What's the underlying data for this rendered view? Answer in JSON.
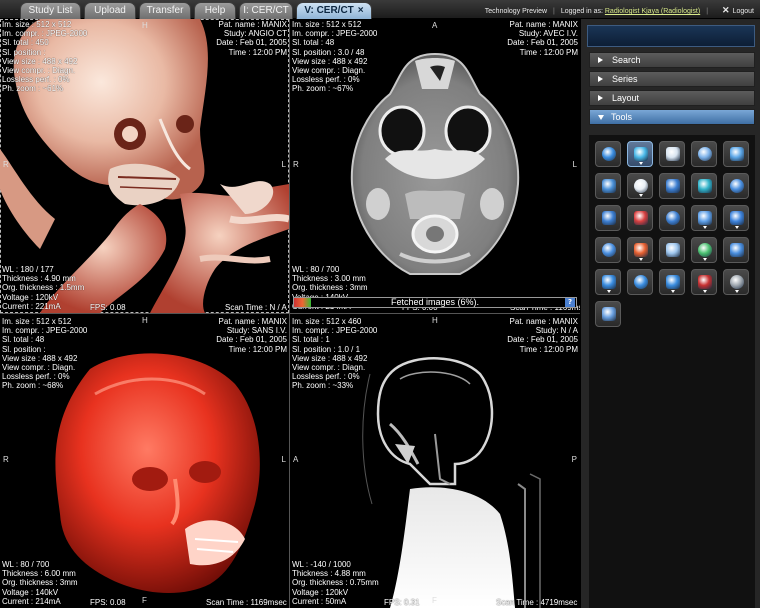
{
  "tabs": [
    {
      "label": "Study List",
      "active": false
    },
    {
      "label": "Upload",
      "active": false
    },
    {
      "label": "Transfer",
      "active": false
    },
    {
      "label": "Help",
      "active": false
    },
    {
      "label": "I: CER/CT",
      "active": false
    },
    {
      "label": "V: CER/CT",
      "active": true,
      "close": "×"
    }
  ],
  "header": {
    "tech_preview": "Technology Preview",
    "logged_in_as": "Logged in as:",
    "user": "Radiologist Kjaya (Radiologist)",
    "logout": "Logout",
    "logout_icon": "close-icon"
  },
  "viewports": {
    "top_left": {
      "left_lines": [
        "Im. size : 512 x 512",
        "Im. compr. : JPEG-2000",
        "Sl. total : 450",
        "Sl. position :",
        "View size : 488 x 492",
        "View compr. : Diagn.",
        "Lossless perf. : 0%",
        "Ph. zoom : ~61%"
      ],
      "right_lines": [
        "Pat. name : MANIX",
        "Study: ANGIO CT",
        "Date : Feb 01, 2005",
        "Time : 12:00 PM"
      ],
      "bottom_lines": [
        "WL : 180 / 177",
        "Thickness : 4.90 mm",
        "Org. thickness : 1.5mm",
        "Voltage : 120kV",
        "Current : 221mA"
      ],
      "fps": "FPS: 0.08",
      "scan": "Scan Time : N / A",
      "orient": {
        "top": "H",
        "left": "R",
        "right": "L",
        "bottom": "F"
      }
    },
    "top_right": {
      "left_lines": [
        "Im. size : 512 x 512",
        "Im. compr. : JPEG-2000",
        "Sl. total : 48",
        "Sl. position : 3.0 / 48",
        "View size : 488 x 492",
        "View compr. : Diagn.",
        "Lossless perf. : 0%",
        "Ph. zoom : ~67%"
      ],
      "right_lines": [
        "Pat. name : MANIX",
        "Study: AVEC I.V.",
        "Date : Feb 01, 2005",
        "Time : 12:00 PM"
      ],
      "bottom_lines": [
        "WL : 80 / 700",
        "Thickness : 3.00 mm",
        "Org. thickness : 3mm",
        "Voltage : 140kV",
        "Current : 214mA"
      ],
      "fps": "FPS: 0.00",
      "scan": "Scan Time : 1169msec",
      "orient": {
        "top": "A",
        "left": "R",
        "right": "L",
        "bottom": "P"
      }
    },
    "bottom_left": {
      "left_lines": [
        "Im. size : 512 x 512",
        "Im. compr. : JPEG-2000",
        "Sl. total : 48",
        "Sl. position :",
        "View size : 488 x 492",
        "View compr. : Diagn.",
        "Lossless perf. : 0%",
        "Ph. zoom : ~68%"
      ],
      "right_lines": [
        "Pat. name : MANIX",
        "Study: SANS I.V.",
        "Date : Feb 01, 2005",
        "Time : 12:00 PM"
      ],
      "bottom_lines": [
        "WL : 80 / 700",
        "Thickness : 6.00 mm",
        "Org. thickness : 3mm",
        "Voltage : 140kV",
        "Current : 214mA"
      ],
      "fps": "FPS: 0.08",
      "scan": "Scan Time : 1169msec",
      "orient": {
        "top": "H",
        "left": "R",
        "right": "L",
        "bottom": "F"
      }
    },
    "bottom_right": {
      "left_lines": [
        "Im. size : 512 x 460",
        "Im. compr. : JPEG-2000",
        "Sl. total : 1",
        "Sl. position : 1.0 / 1",
        "View size : 488 x 492",
        "View compr. : Diagn.",
        "Lossless perf. : 0%",
        "Ph. zoom : ~33%"
      ],
      "right_lines": [
        "Pat. name : MANIX",
        "Study: N / A",
        "Date : Feb 01, 2005",
        "Time : 12:00 PM"
      ],
      "bottom_lines": [
        "WL : -140 / 1000",
        "Thickness : 4.88 mm",
        "Org. thickness : 0.75mm",
        "Voltage : 120kV",
        "Current : 50mA"
      ],
      "fps": "FPS: 0.31",
      "scan": "Scan Time : 4719msec",
      "orient": {
        "top": "H",
        "left": "A",
        "right": "P",
        "bottom": "F"
      }
    }
  },
  "fetch": {
    "label": "Fetched images (6%).",
    "progress": 0.06,
    "help": "?"
  },
  "panel": {
    "sections": [
      {
        "label": "Search",
        "open": false
      },
      {
        "label": "Series",
        "open": false
      },
      {
        "label": "Layout",
        "open": false
      },
      {
        "label": "Tools",
        "open": true
      }
    ],
    "tools": [
      {
        "name": "reset-view-icon",
        "color": "#3a8de0",
        "dd": false,
        "active": false
      },
      {
        "name": "volume-render-icon",
        "color": "#49b8e8",
        "dd": true,
        "active": true
      },
      {
        "name": "stack-icon",
        "color": "#d8e4f0",
        "dd": false,
        "active": false
      },
      {
        "name": "screen-layout-icon",
        "color": "#7db2ea",
        "dd": false,
        "active": false
      },
      {
        "name": "copy-icon",
        "color": "#5ca7e8",
        "dd": false,
        "active": false
      },
      {
        "name": "flag-icon",
        "color": "#4a90d8",
        "dd": false,
        "active": false
      },
      {
        "name": "window-level-icon",
        "color": "#e8eef4",
        "dd": true,
        "active": false
      },
      {
        "name": "rotate-icon",
        "color": "#3d7fd2",
        "dd": false,
        "active": false
      },
      {
        "name": "crosshair-icon",
        "color": "#31b3c9",
        "dd": false,
        "active": false
      },
      {
        "name": "mip-icon",
        "color": "#4a8fe0",
        "dd": false,
        "active": false
      },
      {
        "name": "previous-icon",
        "color": "#3d7fd2",
        "dd": false,
        "active": false
      },
      {
        "name": "stop-icon",
        "color": "#d84040",
        "dd": false,
        "active": false
      },
      {
        "name": "next-icon",
        "color": "#3d7fd2",
        "dd": false,
        "active": false
      },
      {
        "name": "document-icon",
        "color": "#5fa0e8",
        "dd": true,
        "active": false
      },
      {
        "name": "star-icon",
        "color": "#3e84dd",
        "dd": true,
        "active": false
      },
      {
        "name": "camera-icon",
        "color": "#4a8fe0",
        "dd": false,
        "active": false
      },
      {
        "name": "color-map-icon",
        "color": "#e86030",
        "dd": true,
        "active": false
      },
      {
        "name": "tools-icon",
        "color": "#9fc7ef",
        "dd": false,
        "active": false
      },
      {
        "name": "measure-icon",
        "color": "#4ac070",
        "dd": true,
        "active": false
      },
      {
        "name": "aperture-icon",
        "color": "#4a8fe0",
        "dd": false,
        "active": false
      },
      {
        "name": "database-icon",
        "color": "#3a8de0",
        "dd": true,
        "active": false
      },
      {
        "name": "body-scan-icon",
        "color": "#3a8de0",
        "dd": false,
        "active": false
      },
      {
        "name": "layers-icon",
        "color": "#3a8de0",
        "dd": true,
        "active": false
      },
      {
        "name": "head-red-icon",
        "color": "#c83030",
        "dd": true,
        "active": false
      },
      {
        "name": "head-gray-icon",
        "color": "#a0a8b0",
        "dd": true,
        "active": false
      },
      {
        "name": "glasses-icon",
        "color": "#6aa0e0",
        "dd": false,
        "active": false
      }
    ]
  }
}
